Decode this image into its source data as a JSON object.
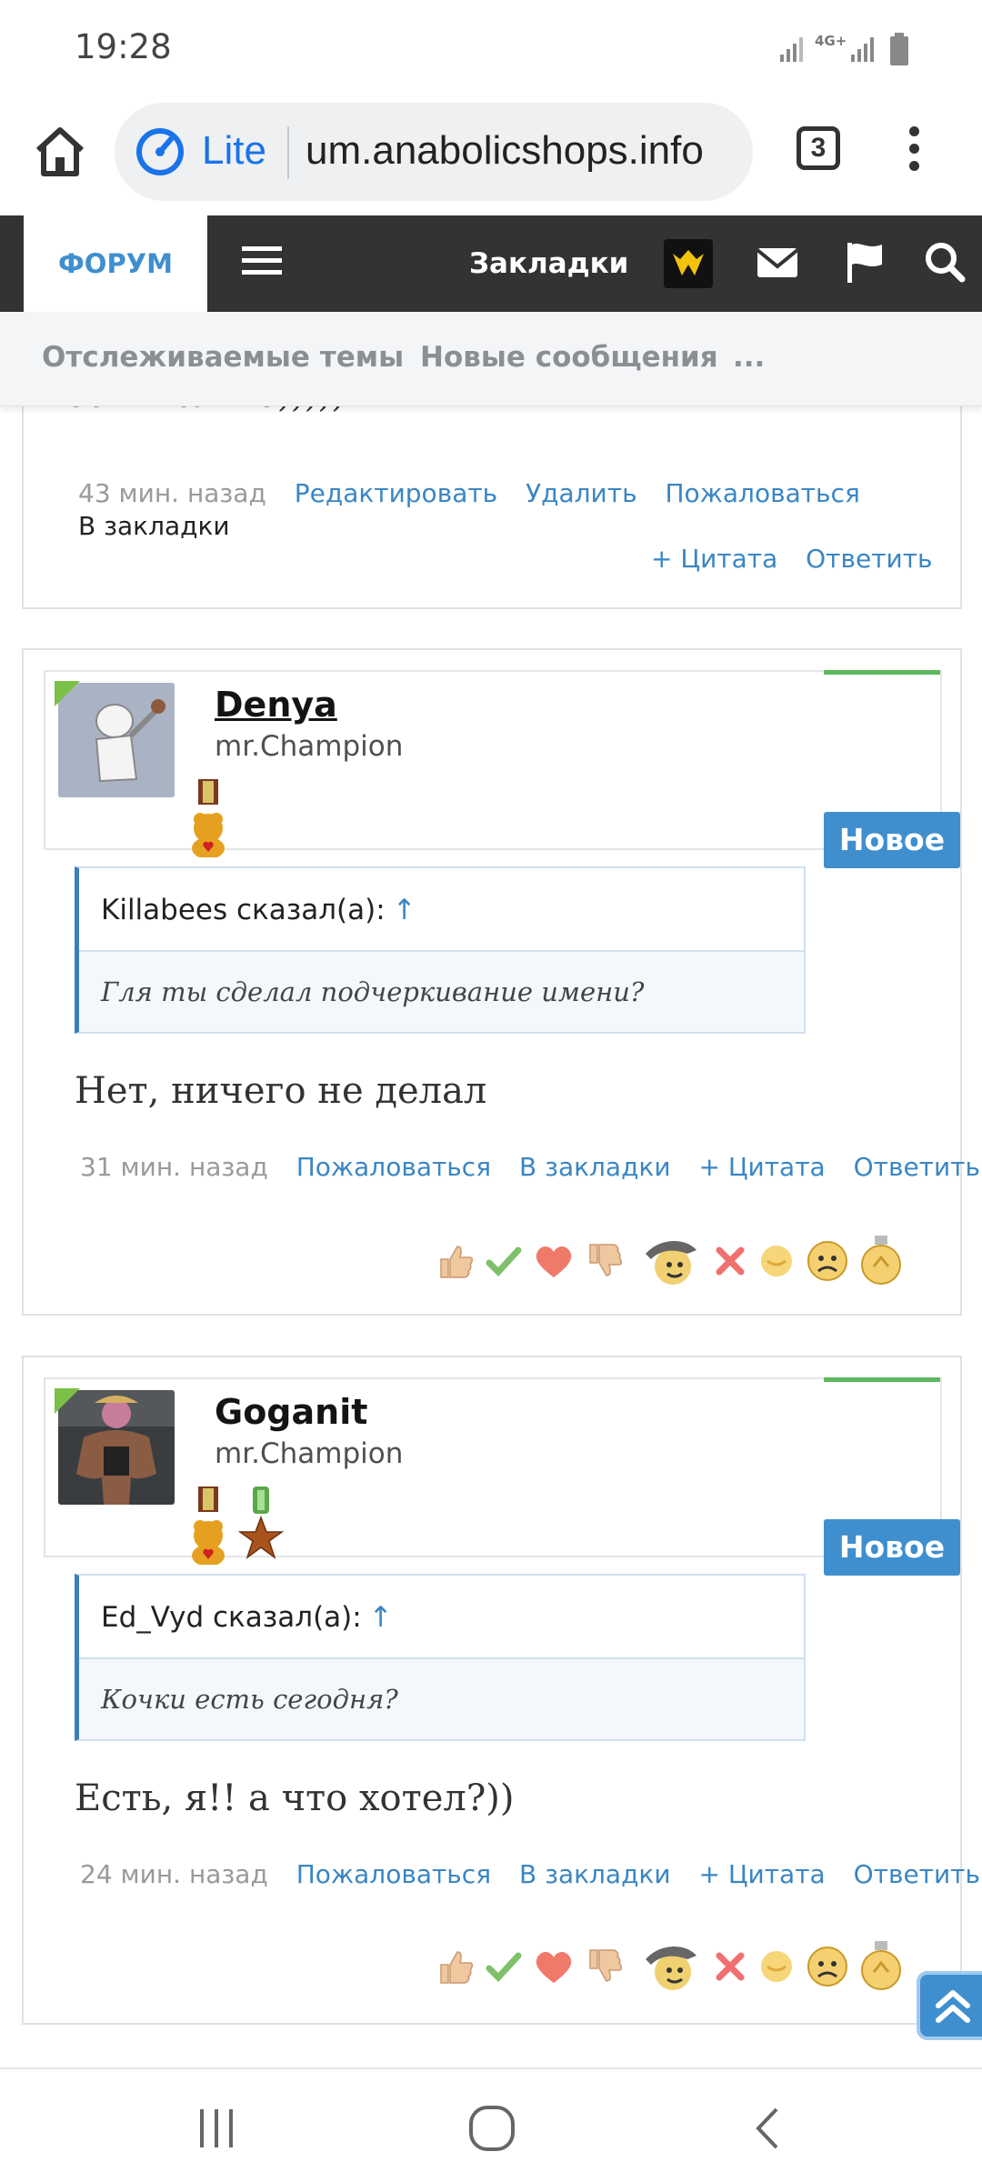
{
  "status_bar": {
    "time": "19:28",
    "network": "4G+"
  },
  "browser": {
    "lite_label": "Lite",
    "url": "um.anabolicshops.info",
    "tab_count": "3"
  },
  "navbar": {
    "forum_tab": "ФОРУМ",
    "bookmarks": "Закладки"
  },
  "subnav": {
    "watched": "Отслеживаемые темы",
    "new_messages": "Новые сообщения",
    "more": "..."
  },
  "post0": {
    "cut_text": "есть только)))))",
    "time": "43 мин. назад",
    "actions": [
      "Редактировать",
      "Удалить",
      "Пожаловаться",
      "В закладки"
    ],
    "quote_label": "+ Цитата",
    "reply_label": "Ответить"
  },
  "post1": {
    "username": "Denya",
    "user_title": "mr.Champion",
    "badge": "Новое",
    "quote_author": "Killabees сказал(а):",
    "quote_arrow": "↑",
    "quote_text": "Гля ты сделал подчеркивание имени?",
    "body": "Нет, ничего не делал",
    "time": "31 мин. назад",
    "report": "Пожаловаться",
    "bookmark": "В закладки",
    "quote_label": "+ Цитата",
    "reply_label": "Ответить"
  },
  "post2": {
    "username": "Goganit",
    "user_title": "mr.Champion",
    "badge": "Новое",
    "quote_author": "Ed_Vyd сказал(а):",
    "quote_arrow": "↑",
    "quote_text": "Кочки есть сегодня?",
    "body": "Есть, я!! а что хотел?))",
    "time": "24 мин. назад",
    "report": "Пожаловаться",
    "bookmark": "В закладки",
    "quote_label": "+ Цитата",
    "reply_label": "Ответить"
  },
  "reactions": [
    "thumbs-up",
    "checkmark",
    "heart",
    "thumbs-down",
    "troll-smiley",
    "x-mark",
    "smile",
    "sad",
    "medal"
  ],
  "colors": {
    "accent": "#3f8fcf",
    "navbar": "#333333",
    "link": "#3a86c4",
    "online": "#7cc047"
  }
}
